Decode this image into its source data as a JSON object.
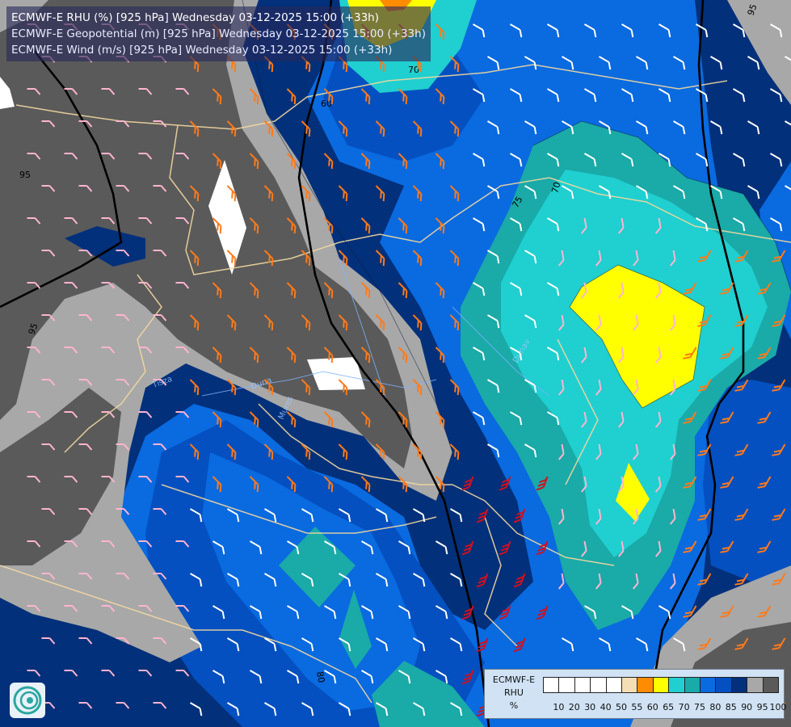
{
  "header": {
    "lines": [
      "ECMWF-E RHU (%) [925 hPa] Wednesday 03-12-2025 15:00 (+33h)",
      "ECMWF-E Geopotential (m) [925 hPa] Wednesday 03-12-2025 15:00 (+33h)",
      "ECMWF-E Wind (m/s) [925 hPa] Wednesday 03-12-2025 15:00 (+33h)"
    ]
  },
  "map": {
    "geopotential_labels": [
      "60",
      "60",
      "60",
      "70",
      "80",
      "95",
      "95",
      "95",
      "95"
    ],
    "contour_labels": [
      "70",
      "75",
      "80",
      "95"
    ],
    "place_labels": [
      "Tisza",
      "Duna",
      "Dunav",
      "Mures"
    ]
  },
  "legend": {
    "model": "ECMWF-E",
    "variable": "RHU",
    "unit": "%",
    "ticks": [
      "10",
      "20",
      "30",
      "40",
      "50",
      "55",
      "60",
      "65",
      "70",
      "75",
      "80",
      "85",
      "90",
      "95",
      "100"
    ],
    "colors": [
      "#ffffff",
      "#ffffff",
      "#ffffff",
      "#ffffff",
      "#ffffff",
      "#f5deb3",
      "#ff8c00",
      "#ffff00",
      "#20cfcf",
      "#1aaaa8",
      "#0a6ae0",
      "#0450c0",
      "#02307a",
      "#a8a8a8",
      "#5a5a5a"
    ]
  },
  "colors": {
    "rh_95_100": "#5a5a5a",
    "rh_90_95": "#a8a8a8",
    "rh_85_90": "#02307a",
    "rh_80_85": "#0450c0",
    "rh_75_80": "#0a6ae0",
    "rh_70_75": "#1aaaa8",
    "rh_65_70": "#20cfcf",
    "rh_60_65": "#ffff00",
    "border": "#f2d8a0",
    "isohypse": "#000000"
  }
}
